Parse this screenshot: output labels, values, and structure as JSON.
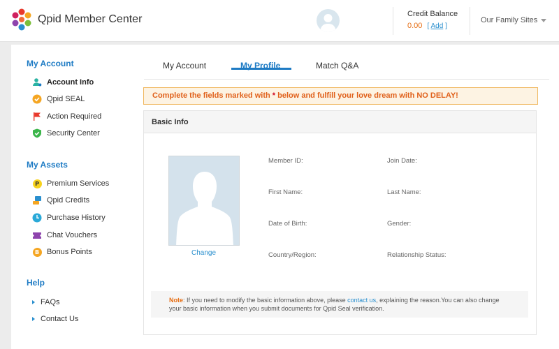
{
  "header": {
    "brand": "Qpid Member Center",
    "credit_title": "Credit Balance",
    "credit_value": "0.00",
    "credit_add_label": "Add",
    "family_sites": "Our Family Sites"
  },
  "sidebar": {
    "account_title": "My Account",
    "account_items": [
      {
        "label": "Account Info",
        "icon": "user-icon"
      },
      {
        "label": "Qpid SEAL",
        "icon": "seal-icon"
      },
      {
        "label": "Action Required",
        "icon": "flag-icon"
      },
      {
        "label": "Security Center",
        "icon": "shield-icon"
      }
    ],
    "assets_title": "My Assets",
    "asset_items": [
      {
        "label": "Premium Services",
        "icon": "premium-icon",
        "glyph": "P"
      },
      {
        "label": "Qpid Credits",
        "icon": "credits-icon"
      },
      {
        "label": "Purchase History",
        "icon": "clock-icon"
      },
      {
        "label": "Chat Vouchers",
        "icon": "voucher-icon"
      },
      {
        "label": "Bonus Points",
        "icon": "bonus-icon",
        "glyph": "B"
      }
    ],
    "help_title": "Help",
    "help_items": [
      {
        "label": "FAQs"
      },
      {
        "label": "Contact Us"
      }
    ]
  },
  "tabs": [
    {
      "label": "My Account"
    },
    {
      "label": "My Profile",
      "active": true
    },
    {
      "label": "Match Q&A"
    }
  ],
  "alert": {
    "before": "Complete the fields marked with ",
    "star": "*",
    "after": " below and fulfill your love dream with NO DELAY!"
  },
  "panel": {
    "title": "Basic Info",
    "change_label": "Change",
    "fields": {
      "member_id": "Member ID:",
      "join_date": "Join Date:",
      "first_name": "First Name:",
      "last_name": "Last Name:",
      "dob": "Date of Birth:",
      "gender": "Gender:",
      "country": "Country/Region:",
      "relationship": "Relationship Status:"
    },
    "note": {
      "label": "Note",
      "text1": ": If you need to modify the basic information above, please ",
      "link": "contact us",
      "text2": ", explaining the reason.You can also change",
      "text3": "your basic information when you submit documents for Qpid Seal verification."
    }
  },
  "colors": {
    "accent": "#1e7bc4",
    "orange": "#e66d12",
    "link": "#2a8fce"
  }
}
